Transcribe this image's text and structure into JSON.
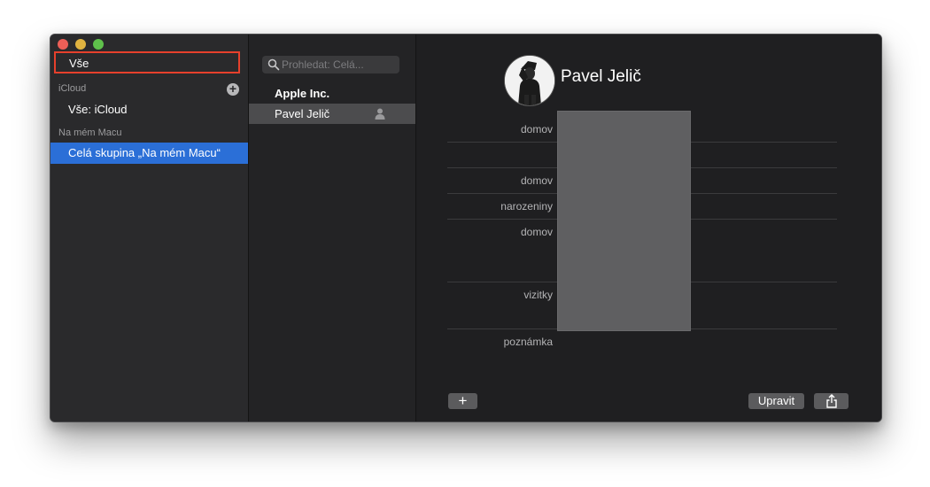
{
  "sidebar": {
    "all_label": "Vše",
    "icloud_section": "iCloud",
    "icloud_all": "Vše: iCloud",
    "mac_section": "Na mém Macu",
    "mac_group": "Celá skupina „Na mém Macu“",
    "add_icon": "plus-circle-icon"
  },
  "search": {
    "placeholder": "Prohledat: Celá..."
  },
  "list": {
    "items": [
      {
        "name": "Apple Inc."
      },
      {
        "name": "Pavel Jelič"
      }
    ]
  },
  "detail": {
    "name": "Pavel Jelič",
    "labels": [
      "domov",
      "domov",
      "narozeniny",
      "domov",
      "vizitky",
      "poznámka"
    ]
  },
  "buttons": {
    "add": "+",
    "edit": "Upravit",
    "share_icon": "share-icon"
  },
  "colors": {
    "selection": "#2b6fd7",
    "highlight_border": "#e6402c"
  }
}
